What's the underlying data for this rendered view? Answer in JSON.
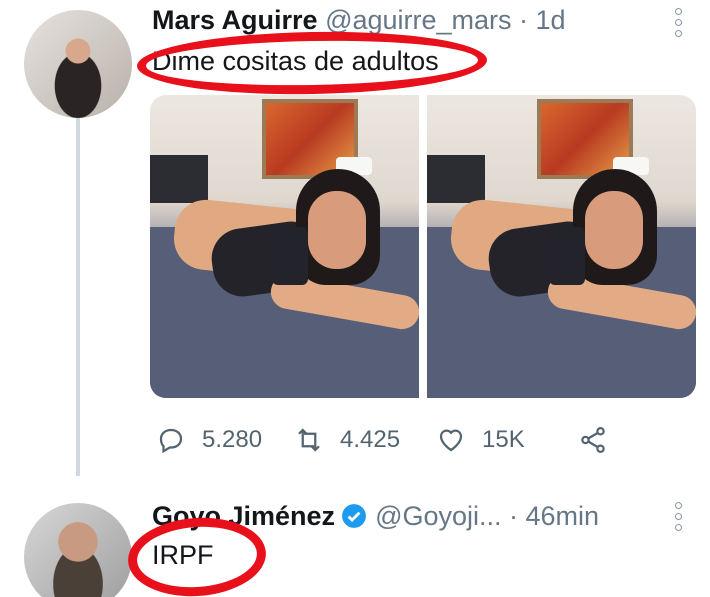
{
  "tweet1": {
    "display_name": "Mars Aguirre",
    "handle": "@aguirre_mars",
    "time": "· 1d",
    "text": "Dime cositas de adultos",
    "reply_count": "5.280",
    "retweet_count": "4.425",
    "like_count": "15K"
  },
  "tweet2": {
    "display_name": "Goyo Jiménez",
    "handle": "@Goyoji...",
    "time": "· 46min",
    "text": "IRPF"
  },
  "icons": {
    "reply": "reply-icon",
    "retweet": "retweet-icon",
    "like": "heart-icon",
    "share": "share-icon",
    "verified": "verified-badge-icon",
    "more": "more-options-icon"
  },
  "colors": {
    "annotation": "#e8101b",
    "verified": "#1d9bf0",
    "muted_text": "#657786"
  }
}
